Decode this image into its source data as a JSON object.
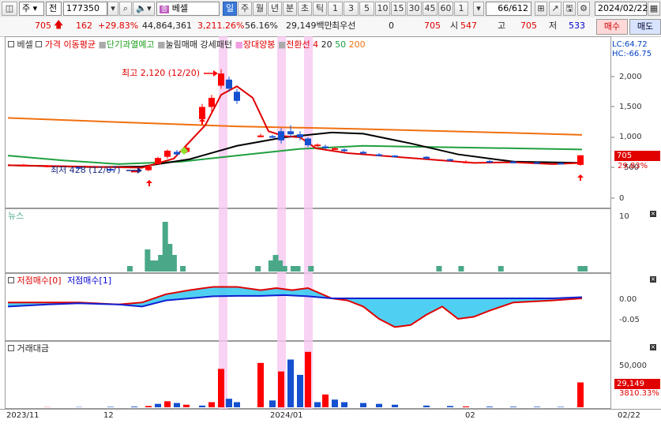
{
  "toolbar": {
    "dropdown1": "주",
    "dropdown2": "전",
    "code": "177350",
    "name": "베셀",
    "periods": [
      "일",
      "주",
      "월",
      "년",
      "분",
      "초",
      "틱"
    ],
    "numbers": [
      "1",
      "3",
      "5",
      "10",
      "15",
      "30",
      "45",
      "60",
      "1"
    ],
    "page": "66/612",
    "date": "2024/02/22"
  },
  "info": {
    "price": "705",
    "change": "162",
    "change_pct": "+29.83%",
    "volume": "44,864,361",
    "vol_pct": "3,211.26%",
    "ratio": "56.16%",
    "amount": "29,149백만",
    "priority": "최우선",
    "zero": "0",
    "price2": "705",
    "open_label": "시",
    "open": "547",
    "high_label": "고",
    "high": "705",
    "low_label": "저",
    "low": "533",
    "buy": "매수",
    "sell": "매도"
  },
  "legend": {
    "name": "베셀",
    "items": [
      "가격 이동평균",
      "단기과열예고",
      "눌림매매 강세패턴",
      "장대양봉",
      "전환선 4",
      "20",
      "50",
      "200"
    ],
    "lc": "LC:64.72",
    "hc": "HC:-66.75"
  },
  "colors": {
    "up": "#ff0000",
    "down": "#1450d0",
    "ma4": "#e00000",
    "ma20": "#000000",
    "ma50": "#20a040",
    "ma200": "#f07010",
    "news": "#4aa888",
    "highlight": "#f8c8f0"
  },
  "annotations": {
    "high": "최고 2,120 (12/20)",
    "low": "최저 428 (12/07)"
  },
  "price_axis": {
    "ticks": [
      "2,000",
      "1,500",
      "1,000",
      "500",
      "0"
    ],
    "last": "705",
    "last_pct": "29.83%"
  },
  "news": {
    "title": "뉴스",
    "tick": "10",
    "values": [
      0,
      0,
      0,
      0,
      0,
      0,
      0,
      0,
      0,
      0,
      0,
      0,
      0,
      0,
      0,
      0,
      0,
      0,
      0,
      0,
      0,
      0,
      0,
      0,
      0,
      0,
      0,
      1,
      0,
      0,
      0,
      4,
      2,
      2,
      3,
      9,
      5,
      3,
      0,
      1,
      0,
      0,
      0,
      0,
      0,
      0,
      0,
      0,
      0,
      0,
      0,
      0,
      0,
      0,
      0,
      0,
      1,
      0,
      0,
      2,
      3,
      2,
      1,
      0,
      1,
      1,
      0,
      0,
      1,
      0,
      0,
      0,
      0,
      0,
      0,
      0,
      0,
      0,
      0,
      0,
      0,
      0,
      0,
      0,
      0,
      0,
      0,
      0,
      0,
      0,
      0,
      0,
      0,
      0,
      0,
      0,
      0,
      1,
      0,
      0,
      0,
      0,
      1,
      0,
      0,
      0,
      0,
      0,
      0,
      0,
      0,
      1,
      0,
      0,
      0,
      0,
      0,
      0,
      0,
      0,
      0,
      0,
      0,
      0,
      0,
      0,
      0,
      0,
      0,
      1,
      1
    ]
  },
  "indicator": {
    "title0": "저점매수[0]",
    "title1": "저점매수[1]",
    "ticks": [
      "0.00",
      "-0.05"
    ]
  },
  "trade_value": {
    "title": "거래대금",
    "tick": "50,000",
    "last": "29,149",
    "last_pct": "3810.33%"
  },
  "x_axis": {
    "labels": [
      "2023/11",
      "12",
      "2024/01",
      "02",
      "02/22"
    ]
  }
}
